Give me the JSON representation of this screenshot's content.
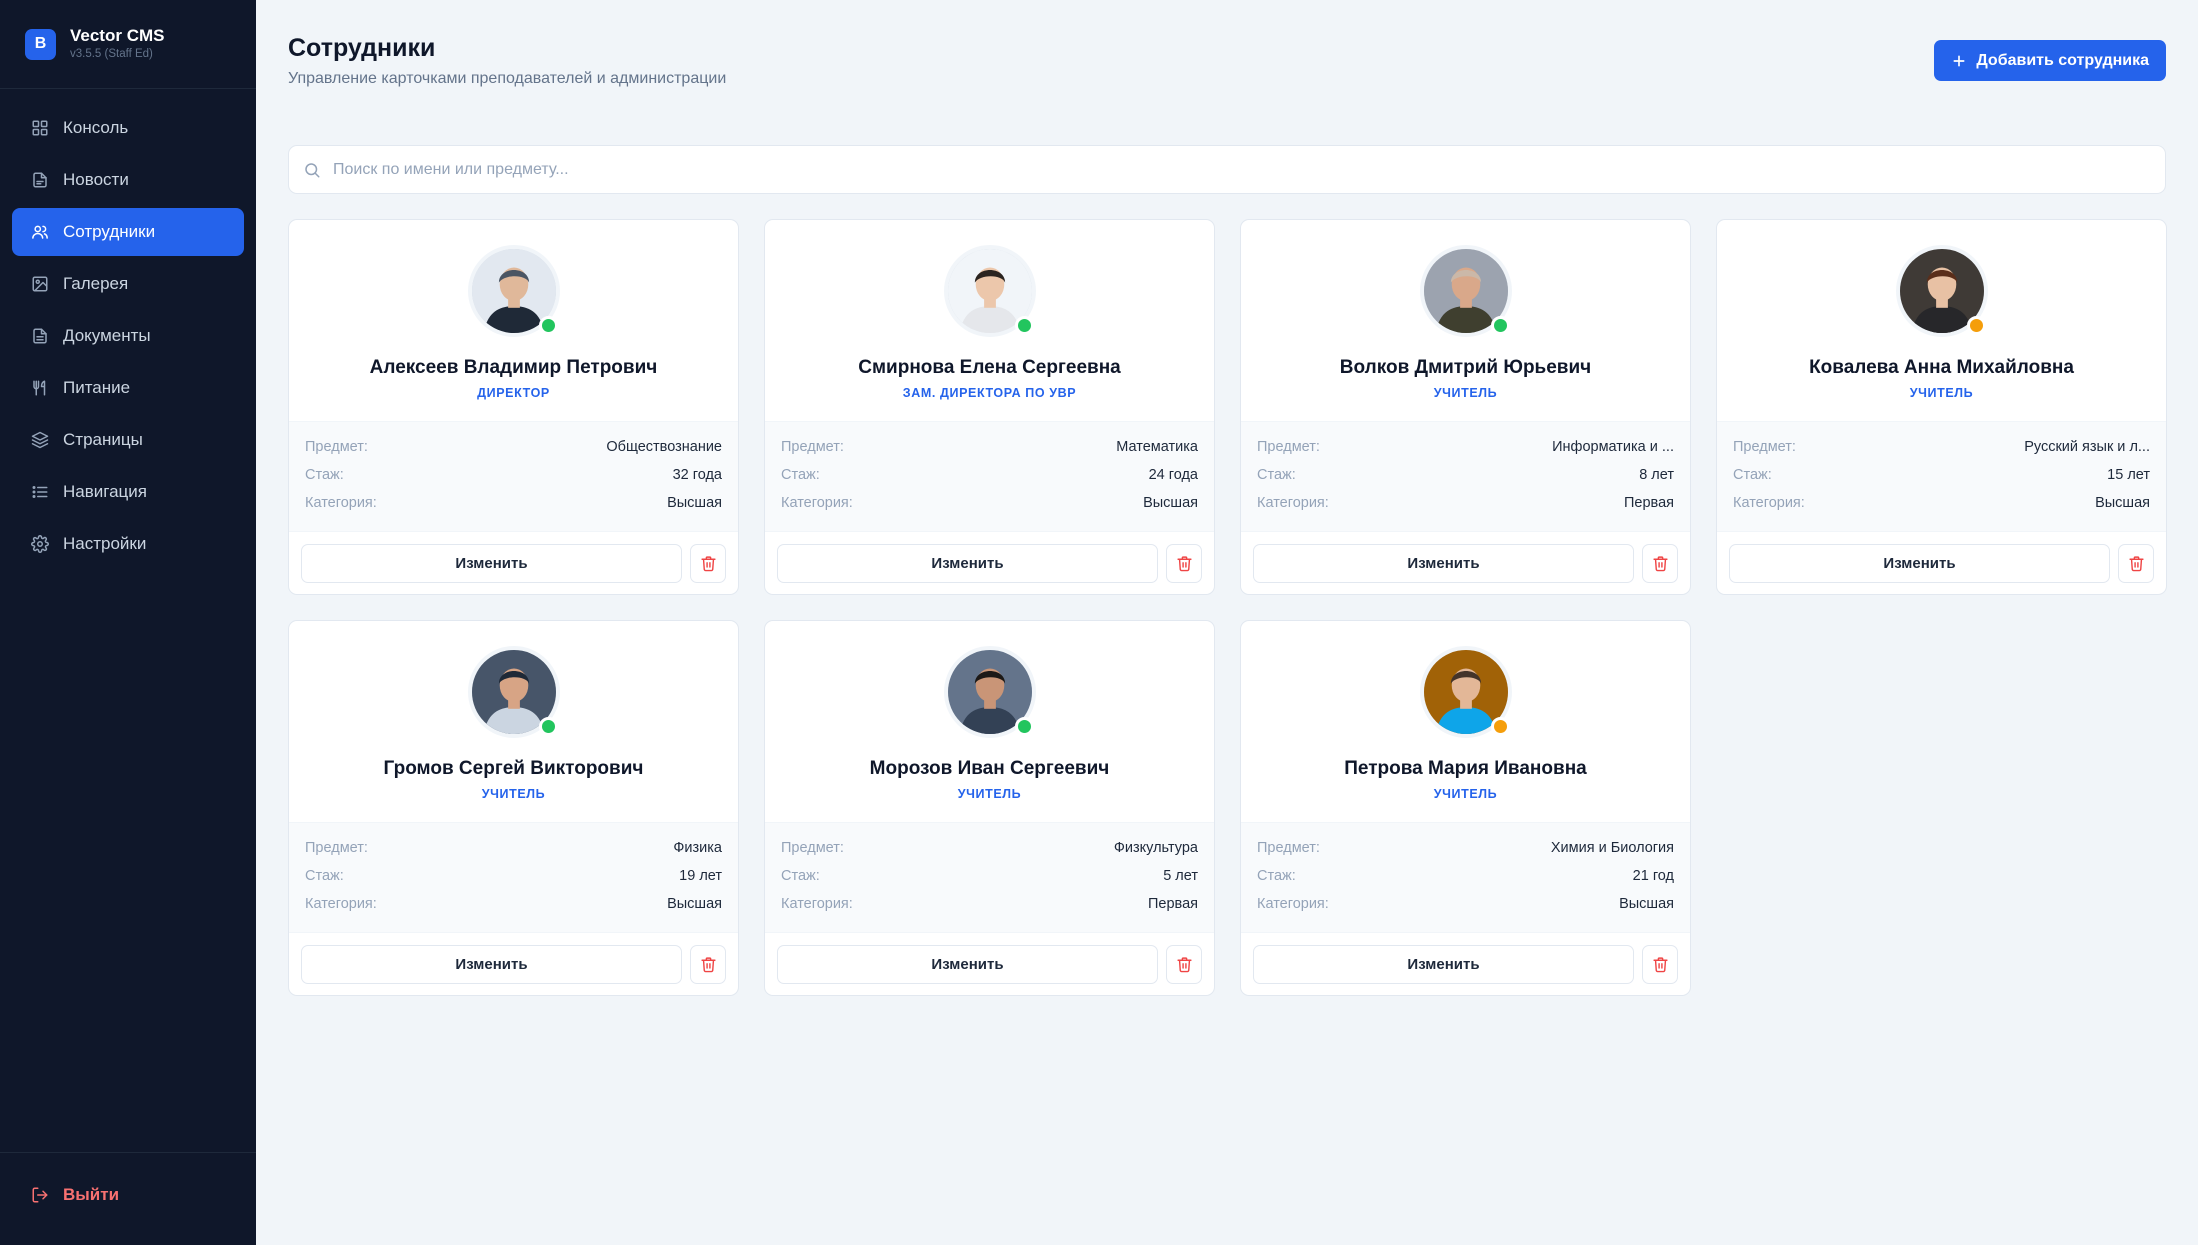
{
  "brand": {
    "logo_letter": "B",
    "name": "Vector CMS",
    "version": "v3.5.5 (Staff Ed)"
  },
  "nav": [
    {
      "label": "Консоль",
      "icon": "dashboard-icon",
      "active": false
    },
    {
      "label": "Новости",
      "icon": "news-icon",
      "active": false
    },
    {
      "label": "Сотрудники",
      "icon": "users-icon",
      "active": true
    },
    {
      "label": "Галерея",
      "icon": "image-icon",
      "active": false
    },
    {
      "label": "Документы",
      "icon": "document-icon",
      "active": false
    },
    {
      "label": "Питание",
      "icon": "utensils-icon",
      "active": false
    },
    {
      "label": "Страницы",
      "icon": "layers-icon",
      "active": false
    },
    {
      "label": "Навигация",
      "icon": "list-icon",
      "active": false
    },
    {
      "label": "Настройки",
      "icon": "gear-icon",
      "active": false
    }
  ],
  "logout": {
    "label": "Выйти",
    "icon": "logout-icon"
  },
  "header": {
    "title": "Сотрудники",
    "subtitle": "Управление карточками преподавателей и администрации",
    "add_button": "Добавить сотрудника"
  },
  "search": {
    "placeholder": "Поиск по имени или предмету...",
    "value": ""
  },
  "labels": {
    "subject": "Предмет:",
    "experience": "Стаж:",
    "category": "Категория:",
    "edit": "Изменить"
  },
  "colors": {
    "accent": "#2563eb",
    "sidebar": "#0f172a",
    "online": "#22c55e",
    "away": "#f59e0b",
    "danger": "#ef4444"
  },
  "staff": [
    {
      "name": "Алексеев Владимир Петрович",
      "role": "Директор",
      "subject": "Обществознание",
      "experience": "32 года",
      "category": "Высшая",
      "status": "online"
    },
    {
      "name": "Смирнова Елена Сергеевна",
      "role": "Зам. директора по УВР",
      "subject": "Математика",
      "experience": "24 года",
      "category": "Высшая",
      "status": "online"
    },
    {
      "name": "Волков Дмитрий Юрьевич",
      "role": "Учитель",
      "subject": "Информатика и ...",
      "experience": "8 лет",
      "category": "Первая",
      "status": "online"
    },
    {
      "name": "Ковалева Анна Михайловна",
      "role": "Учитель",
      "subject": "Русский язык и л...",
      "experience": "15 лет",
      "category": "Высшая",
      "status": "away"
    },
    {
      "name": "Громов Сергей Викторович",
      "role": "Учитель",
      "subject": "Физика",
      "experience": "19 лет",
      "category": "Высшая",
      "status": "online"
    },
    {
      "name": "Морозов Иван Сергеевич",
      "role": "Учитель",
      "subject": "Физкультура",
      "experience": "5 лет",
      "category": "Первая",
      "status": "online"
    },
    {
      "name": "Петрова Мария Ивановна",
      "role": "Учитель",
      "subject": "Химия и Биология",
      "experience": "21 год",
      "category": "Высшая",
      "status": "away"
    }
  ]
}
